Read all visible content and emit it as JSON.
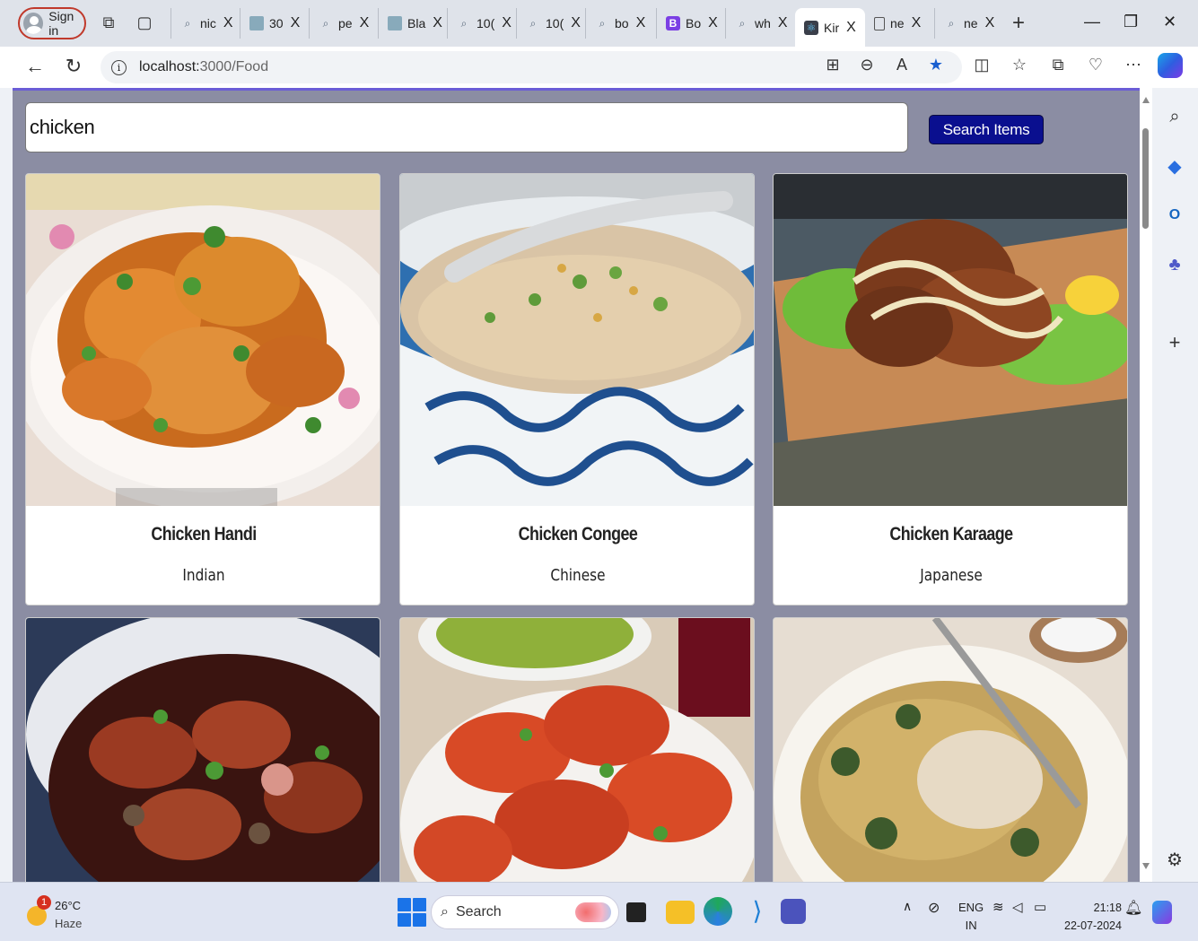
{
  "tabs": {
    "profile_label": "Sign in",
    "items": [
      {
        "label": "nic",
        "icon": "search-icon"
      },
      {
        "label": "30",
        "icon": "image-icon"
      },
      {
        "label": "pe",
        "icon": "search-icon"
      },
      {
        "label": "Bla",
        "icon": "image-icon"
      },
      {
        "label": "10(",
        "icon": "search-icon"
      },
      {
        "label": "10(",
        "icon": "search-icon"
      },
      {
        "label": "bo",
        "icon": "search-icon"
      },
      {
        "label": "Bo",
        "icon": "bootstrap-icon"
      },
      {
        "label": "wh",
        "icon": "search-icon"
      },
      {
        "label": "Kir",
        "icon": "react-icon",
        "active": true
      },
      {
        "label": "ne",
        "icon": "document-icon"
      },
      {
        "label": "ne",
        "icon": "search-icon"
      }
    ],
    "close_glyph": "X",
    "new_tab_glyph": "+"
  },
  "address_bar": {
    "host": "localhost:",
    "path": "3000/Food"
  },
  "search": {
    "value": "chicken",
    "button_label": "Search Items"
  },
  "cards": [
    {
      "title": "Chicken Handi",
      "cuisine": "Indian"
    },
    {
      "title": "Chicken Congee",
      "cuisine": "Chinese"
    },
    {
      "title": "Chicken Karaage",
      "cuisine": "Japanese"
    },
    {
      "title": "",
      "cuisine": ""
    },
    {
      "title": "",
      "cuisine": ""
    },
    {
      "title": "",
      "cuisine": ""
    }
  ],
  "taskbar": {
    "weather_badge": "1",
    "temperature": "26°C",
    "condition": "Haze",
    "search_label": "Search",
    "lang_line1": "ENG",
    "lang_line2": "IN",
    "time": "21:18",
    "date": "22-07-2024"
  },
  "colors": {
    "page_background": "#8b8da3",
    "search_button": "#0a0f8f",
    "profile_border": "#c0392b"
  }
}
